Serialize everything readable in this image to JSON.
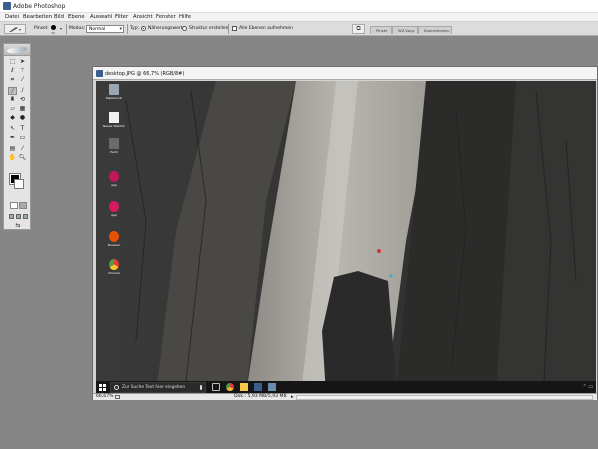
{
  "app": {
    "title": "Adobe Photoshop"
  },
  "menu": [
    "Datei",
    "Bearbeiten",
    "Bild",
    "Ebene",
    "Auswahl",
    "Filter",
    "Ansicht",
    "Fenster",
    "Hilfe"
  ],
  "options_bar": {
    "brush_label": "Pinsel:",
    "brush_size": "34",
    "mode_label": "Modus:",
    "mode_value": "Normal",
    "type_label": "Typ:",
    "type_options": [
      "Näherungswert",
      "Struktur erstellen"
    ],
    "type_selected": "Näherungswert",
    "sample_all_layers": "Alle Ebenen aufnehmen"
  },
  "palette_well": {
    "tabs": [
      "Pinsel",
      "WZ-Vorg.",
      "Ebenenkomp."
    ]
  },
  "document": {
    "title": "desktop.JPG @ 66,7% (RGB/8#)",
    "zoom": "66,67%",
    "doc_size": "Dok.: 5,93 MB/5,93 MB"
  },
  "desktop": {
    "icons": [
      {
        "label": "Papierkorb"
      },
      {
        "label": "Neues Textdok"
      },
      {
        "label": "Paint"
      },
      {
        "label": "App"
      },
      {
        "label": "App"
      },
      {
        "label": "Browser"
      },
      {
        "label": "Chrome"
      }
    ],
    "search_placeholder": "Zur Suche Text hier eingeben"
  },
  "colors": {
    "workspace_bg": "#868686",
    "foreground": "#000000",
    "background": "#ffffff"
  }
}
